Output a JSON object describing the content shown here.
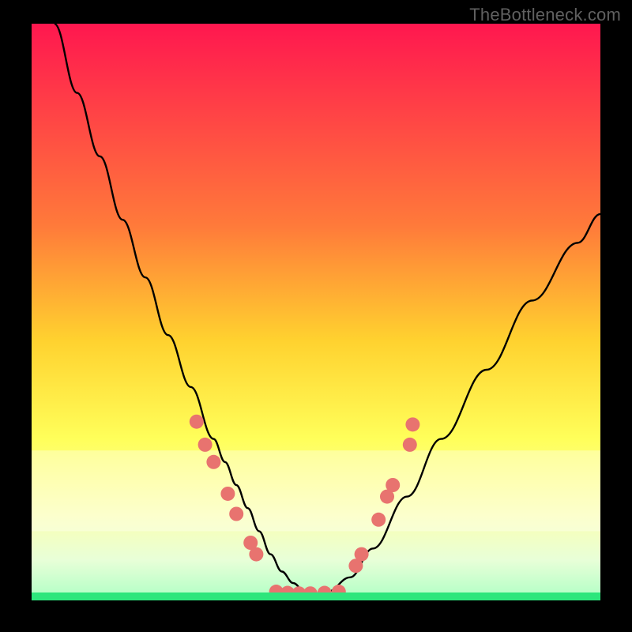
{
  "watermark": "TheBottleneck.com",
  "chart_data": {
    "type": "line",
    "title": "",
    "xlabel": "",
    "ylabel": "",
    "xlim": [
      0,
      100
    ],
    "ylim": [
      0,
      100
    ],
    "gradient_stops": [
      {
        "offset": 0,
        "color": "#ff174f"
      },
      {
        "offset": 35,
        "color": "#ff7a3a"
      },
      {
        "offset": 55,
        "color": "#ffd22f"
      },
      {
        "offset": 72,
        "color": "#ffff5a"
      },
      {
        "offset": 85,
        "color": "#fbffb0"
      },
      {
        "offset": 93,
        "color": "#e8ffd8"
      },
      {
        "offset": 98.6,
        "color": "#b9ffc8"
      },
      {
        "offset": 100,
        "color": "#2de67c"
      }
    ],
    "series": [
      {
        "name": "bottleneck-curve",
        "x": [
          4,
          8,
          12,
          16,
          20,
          24,
          28,
          32,
          34,
          36,
          38,
          40,
          42,
          44,
          46,
          48,
          50,
          52,
          56,
          60,
          66,
          72,
          80,
          88,
          96,
          100
        ],
        "y": [
          100,
          88,
          77,
          66,
          56,
          46,
          37,
          28,
          24,
          20,
          16,
          12,
          8,
          5,
          3,
          1.5,
          1,
          1.5,
          4,
          9,
          18,
          28,
          40,
          52,
          62,
          67
        ]
      }
    ],
    "markers": {
      "name": "marker-dots",
      "color": "#e8736f",
      "radius": 9,
      "points": [
        {
          "x": 29,
          "y": 31
        },
        {
          "x": 30.5,
          "y": 27
        },
        {
          "x": 32,
          "y": 24
        },
        {
          "x": 34.5,
          "y": 18.5
        },
        {
          "x": 36,
          "y": 15
        },
        {
          "x": 38.5,
          "y": 10
        },
        {
          "x": 39.5,
          "y": 8
        },
        {
          "x": 43,
          "y": 1.5
        },
        {
          "x": 45,
          "y": 1.3
        },
        {
          "x": 47,
          "y": 1.2
        },
        {
          "x": 49,
          "y": 1.2
        },
        {
          "x": 51.5,
          "y": 1.3
        },
        {
          "x": 54,
          "y": 1.5
        },
        {
          "x": 57,
          "y": 6
        },
        {
          "x": 58,
          "y": 8
        },
        {
          "x": 61,
          "y": 14
        },
        {
          "x": 62.5,
          "y": 18
        },
        {
          "x": 63.5,
          "y": 20
        },
        {
          "x": 66.5,
          "y": 27
        },
        {
          "x": 67,
          "y": 30.5
        }
      ]
    }
  }
}
